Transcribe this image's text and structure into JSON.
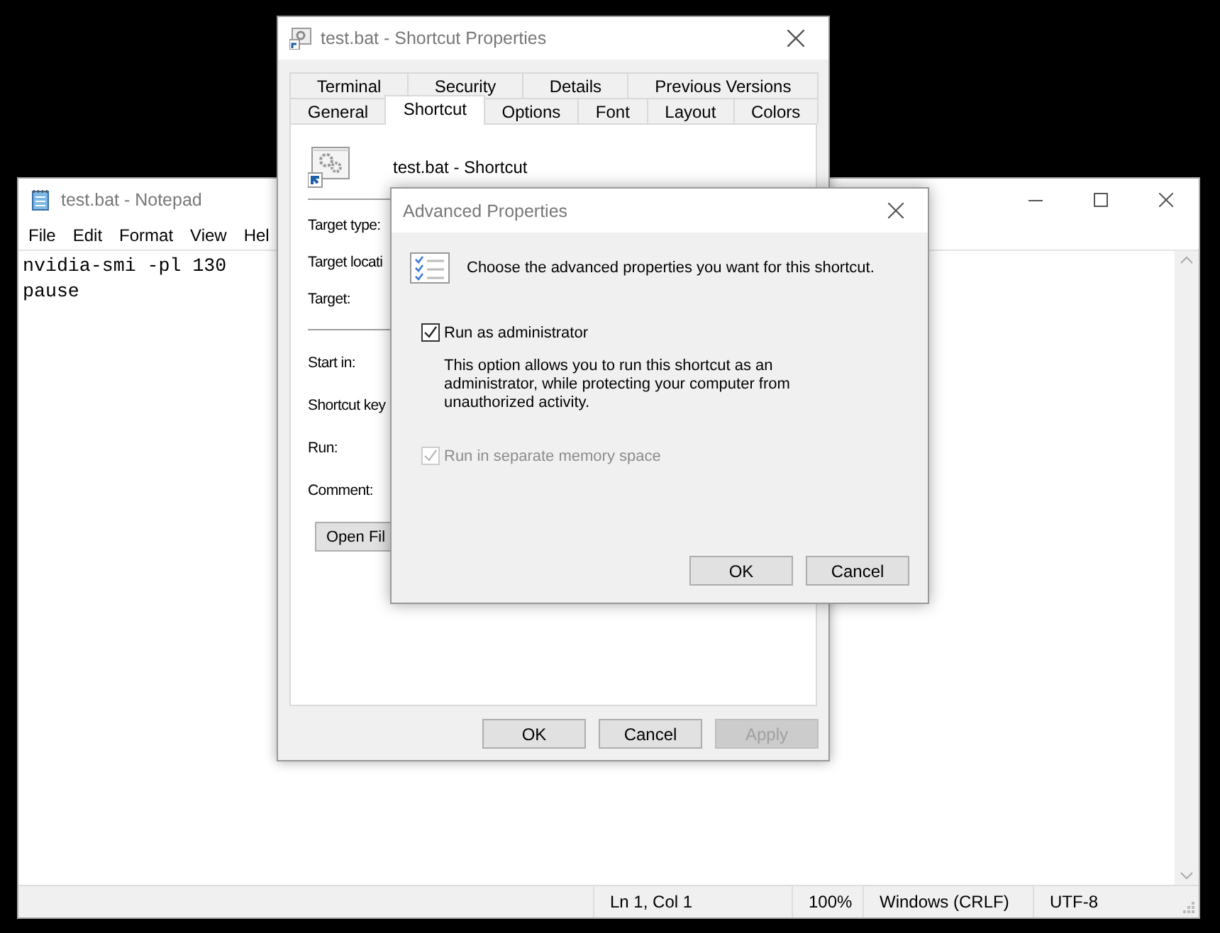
{
  "notepad": {
    "title": "test.bat - Notepad",
    "menu": [
      "File",
      "Edit",
      "Format",
      "View",
      "Hel"
    ],
    "lines": [
      "nvidia-smi -pl 130",
      "pause"
    ],
    "status_bar": [
      "Ln 1, Col 1",
      "100%",
      "Windows (CRLF)",
      "UTF-8"
    ]
  },
  "shortcut_properties": {
    "title": "test.bat - Shortcut Properties",
    "tab_rows": [
      [
        {
          "label": "Terminal",
          "selected": false
        },
        {
          "label": "Security",
          "selected": false
        },
        {
          "label": "Details",
          "selected": false
        },
        {
          "label": "Previous Versions",
          "selected": false
        }
      ],
      [
        {
          "label": "General",
          "selected": false
        },
        {
          "label": "Shortcut",
          "selected": true
        },
        {
          "label": "Options",
          "selected": false
        },
        {
          "label": "Font",
          "selected": false
        },
        {
          "label": "Layout",
          "selected": false
        },
        {
          "label": "Colors",
          "selected": false
        }
      ]
    ],
    "shortcut_name": "test.bat - Shortcut",
    "field_groups": [
      [
        "Target type:",
        "Target locati",
        "Target:"
      ],
      [
        "Start in:",
        "Shortcut key",
        "Run:",
        "Comment:"
      ]
    ],
    "open_file_button": "Open Fil",
    "buttons": [
      {
        "label": "OK",
        "disabled": false
      },
      {
        "label": "Cancel",
        "disabled": false
      },
      {
        "label": "Apply",
        "disabled": true
      }
    ]
  },
  "advanced_properties": {
    "title": "Advanced Properties",
    "heading": "Choose the advanced properties you want for this shortcut.",
    "options": [
      {
        "label": "Run as administrator",
        "checked": true,
        "disabled": false,
        "description": "This option allows you to run this shortcut as an administrator, while protecting your computer from unauthorized activity."
      },
      {
        "label": "Run in separate memory space",
        "checked": true,
        "disabled": true
      }
    ],
    "buttons": [
      {
        "label": "OK",
        "disabled": false
      },
      {
        "label": "Cancel",
        "disabled": false
      }
    ]
  }
}
